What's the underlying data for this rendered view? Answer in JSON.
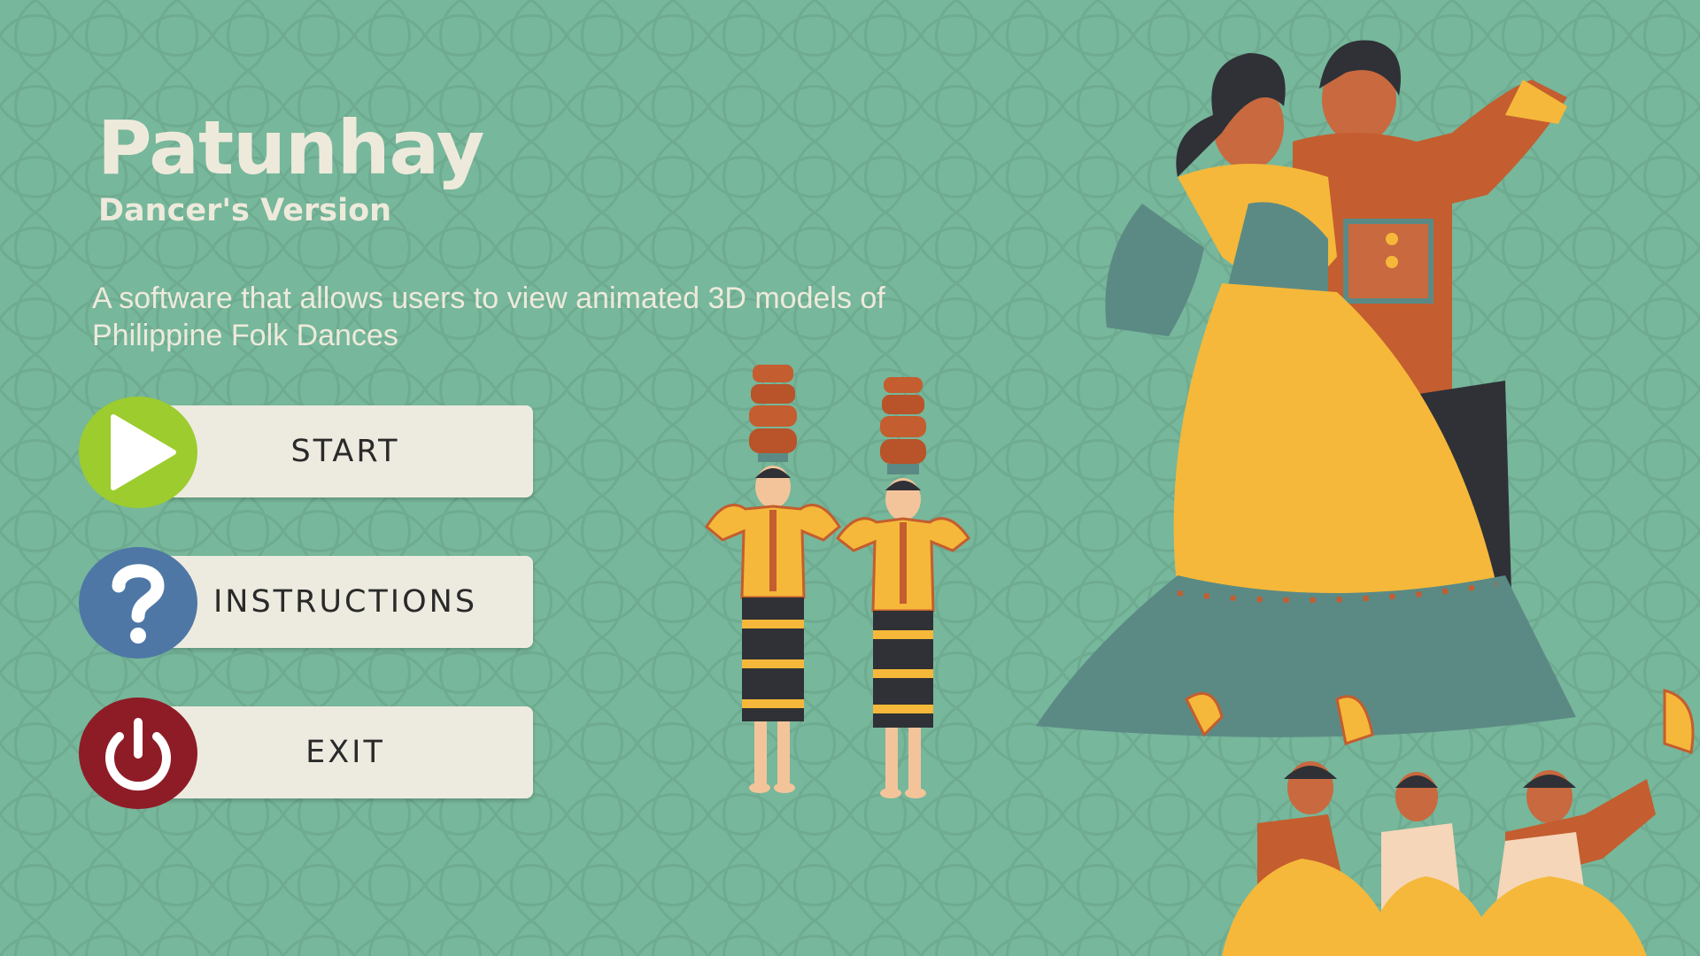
{
  "app": {
    "title": "Patunhay",
    "subtitle": "Dancer's Version",
    "description": "A software that allows users to view animated 3D models of Philippine Folk Dances"
  },
  "menu": {
    "start": {
      "label": "START",
      "icon": "play-icon",
      "color": "#9ccc2e"
    },
    "instructions": {
      "label": "INSTRUCTIONS",
      "icon": "question-mark-icon",
      "color": "#4e77a6"
    },
    "exit": {
      "label": "EXIT",
      "icon": "power-icon",
      "color": "#8e1c26"
    }
  },
  "colors": {
    "background": "#77b79b",
    "title_text": "#eeeadb",
    "button_bar": "#edebdf",
    "yellow": "#f5b83a",
    "orange": "#c45d2f",
    "teal": "#5b8a85"
  }
}
